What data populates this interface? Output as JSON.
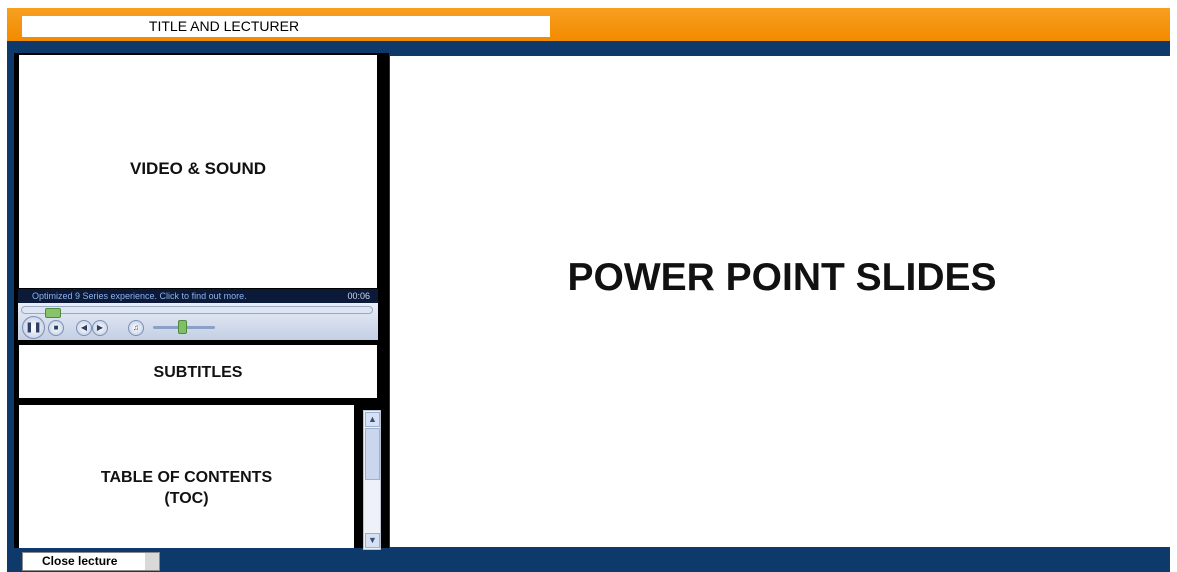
{
  "header": {
    "title": "TITLE AND LECTURER"
  },
  "video": {
    "label": "VIDEO & SOUND"
  },
  "player": {
    "message": "Optimized 9 Series experience.  Click to find out more.",
    "time": "00:06",
    "seek_position": 0.06,
    "volume": 0.4
  },
  "subtitles": {
    "label": "SUBTITLES"
  },
  "toc": {
    "label_line1": "TABLE OF CONTENTS",
    "label_line2": "(TOC)"
  },
  "slides": {
    "label": "POWER POINT SLIDES"
  },
  "footer": {
    "close_label": "Close lecture"
  },
  "icons": [
    "pause-icon",
    "stop-icon",
    "previous-icon",
    "next-icon",
    "mute-icon",
    "scroll-up-icon",
    "scroll-down-icon"
  ],
  "colors": {
    "header": "#f28a00",
    "frame": "#0d3a6b",
    "panel_border": "#000000"
  }
}
